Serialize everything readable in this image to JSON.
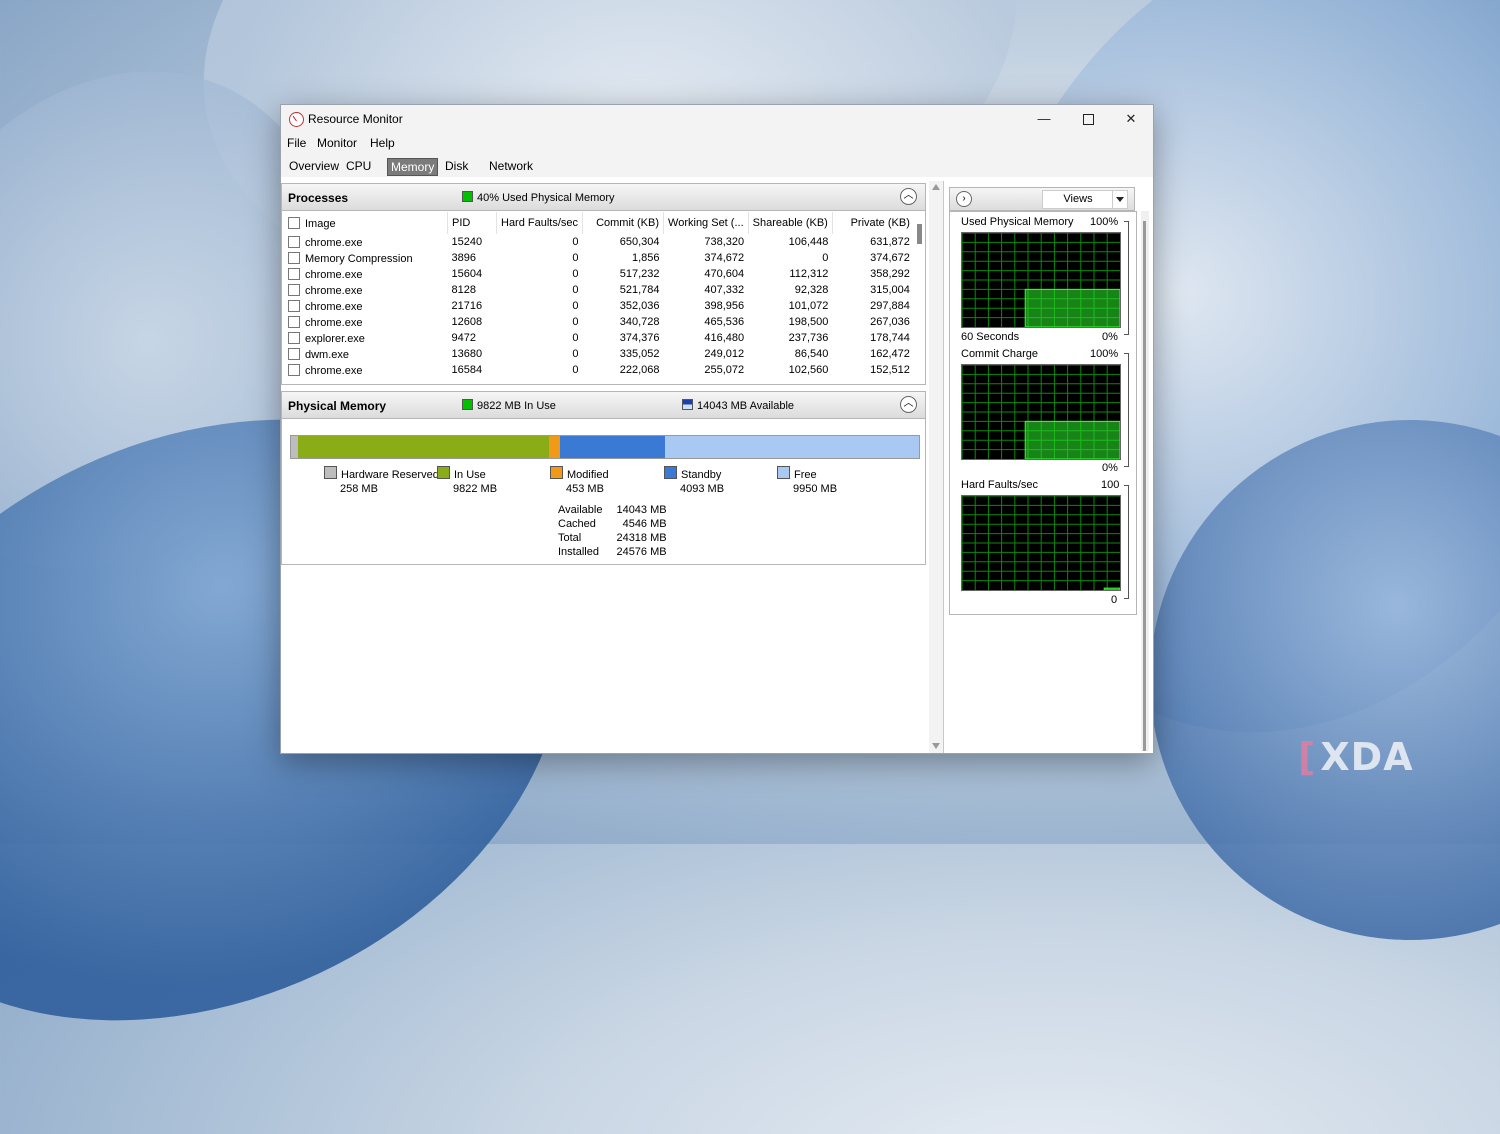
{
  "window": {
    "title": "Resource Monitor",
    "min_glyph": "—",
    "close_glyph": "✕"
  },
  "menu": [
    "File",
    "Monitor",
    "Help"
  ],
  "tabs": [
    "Overview",
    "CPU",
    "Memory",
    "Disk",
    "Network"
  ],
  "active_tab": "Memory",
  "processes": {
    "title": "Processes",
    "status": "40% Used Physical Memory",
    "status_color": "#00c000",
    "columns": [
      "Image",
      "PID",
      "Hard Faults/sec",
      "Commit (KB)",
      "Working Set (...",
      "Shareable (KB)",
      "Private (KB)"
    ],
    "rows": [
      [
        "chrome.exe",
        "15240",
        "0",
        "650,304",
        "738,320",
        "106,448",
        "631,872"
      ],
      [
        "Memory Compression",
        "3896",
        "0",
        "1,856",
        "374,672",
        "0",
        "374,672"
      ],
      [
        "chrome.exe",
        "15604",
        "0",
        "517,232",
        "470,604",
        "112,312",
        "358,292"
      ],
      [
        "chrome.exe",
        "8128",
        "0",
        "521,784",
        "407,332",
        "92,328",
        "315,004"
      ],
      [
        "chrome.exe",
        "21716",
        "0",
        "352,036",
        "398,956",
        "101,072",
        "297,884"
      ],
      [
        "chrome.exe",
        "12608",
        "0",
        "340,728",
        "465,536",
        "198,500",
        "267,036"
      ],
      [
        "explorer.exe",
        "9472",
        "0",
        "374,376",
        "416,480",
        "237,736",
        "178,744"
      ],
      [
        "dwm.exe",
        "13680",
        "0",
        "335,052",
        "249,012",
        "86,540",
        "162,472"
      ],
      [
        "chrome.exe",
        "16584",
        "0",
        "222,068",
        "255,072",
        "102,560",
        "152,512"
      ]
    ]
  },
  "physical_memory": {
    "title": "Physical Memory",
    "in_use_status": "9822 MB In Use",
    "available_status": "14043 MB Available",
    "legend": [
      {
        "label": "Hardware Reserved",
        "value": "258 MB",
        "color": "#bdbdbd",
        "mb": 258
      },
      {
        "label": "In Use",
        "value": "9822 MB",
        "color": "#8aac16",
        "mb": 9822
      },
      {
        "label": "Modified",
        "value": "453 MB",
        "color": "#f09a18",
        "mb": 453
      },
      {
        "label": "Standby",
        "value": "4093 MB",
        "color": "#3b7ad4",
        "mb": 4093
      },
      {
        "label": "Free",
        "value": "9950 MB",
        "color": "#a9c8f2",
        "mb": 9950
      }
    ],
    "totals": [
      [
        "Available",
        "14043 MB"
      ],
      [
        "Cached",
        "4546 MB"
      ],
      [
        "Total",
        "24318 MB"
      ],
      [
        "Installed",
        "24576 MB"
      ]
    ]
  },
  "views_panel": {
    "views_label": "Views",
    "graphs": [
      {
        "title": "Used Physical Memory",
        "max_label": "100%",
        "x_label": "60 Seconds",
        "min_label": "0%",
        "level": 0.4
      },
      {
        "title": "Commit Charge",
        "max_label": "100%",
        "x_label": "",
        "min_label": "0%",
        "level": 0.4
      },
      {
        "title": "Hard Faults/sec",
        "max_label": "100",
        "x_label": "",
        "min_label": "0",
        "level": 0.02
      }
    ]
  },
  "watermark": {
    "bracket": "[",
    "text": "XDA"
  }
}
